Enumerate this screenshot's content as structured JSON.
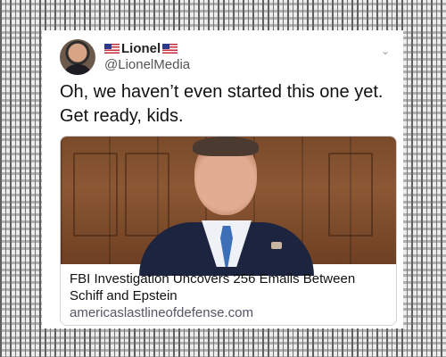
{
  "tweet": {
    "display_name": "Lionel",
    "handle": "@LionelMedia",
    "text": "Oh, we haven’t even started this one yet. Get ready, kids."
  },
  "link_card": {
    "title": "FBI Investigation Uncovers 256 Emails Between Schiff and Epstein",
    "domain": "americaslastlineofdefense.com"
  },
  "icons": {
    "flag": "us-flag-icon",
    "more": "chevron-down-icon"
  }
}
